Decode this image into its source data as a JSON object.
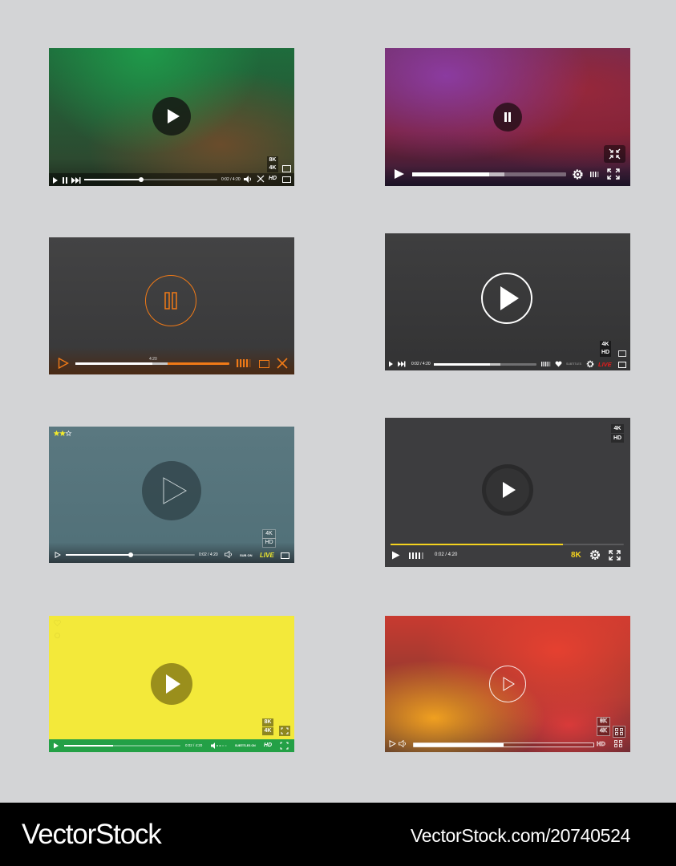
{
  "players": {
    "p1": {
      "time": "0:02 / 4:20",
      "badge_8k": "8K",
      "badge_4k": "4K",
      "badge_hd": "HD",
      "progress": 0.43,
      "volume": 0.6
    },
    "p2": {
      "progress": 0.5,
      "buffered": 0.6
    },
    "p3": {
      "tooltip_time": "4:20",
      "progress": 0.5,
      "buffered": 0.6,
      "accent": "#f07a17"
    },
    "p4": {
      "time": "0:02 / 4:20",
      "subtitles": "SUBTITLES",
      "live": "LIVE",
      "badge_4k": "4K",
      "badge_hd": "HD",
      "progress": 0.55,
      "buffered": 0.65,
      "live_color": "#e41b1b"
    },
    "p5": {
      "time": "0:02 / 4:20",
      "subtitles": "SUB ON",
      "live": "LIVE",
      "badge_4k": "4K",
      "badge_hd": "HD",
      "progress": 0.5,
      "rating": 2,
      "rating_max": 3,
      "accent": "#f4ec2c"
    },
    "p6": {
      "time": "0:02 / 4:20",
      "quality": "8K",
      "badge_4k": "4K",
      "badge_hd": "HD",
      "progress": 0.74,
      "accent": "#f4d21e"
    },
    "p7": {
      "time": "0:02 / 4:20",
      "subtitles": "SUBTITLES ON",
      "badge_hd": "HD",
      "badge_8k": "8K",
      "badge_4k": "4K",
      "progress": 0.42,
      "bar_color": "#23a046"
    },
    "p8": {
      "badge_8k": "8K",
      "badge_4k": "4K",
      "badge_hd": "HD",
      "progress": 0.5
    }
  },
  "footer": {
    "brand": "VectorStock",
    "url": "VectorStock.com/20740524"
  }
}
